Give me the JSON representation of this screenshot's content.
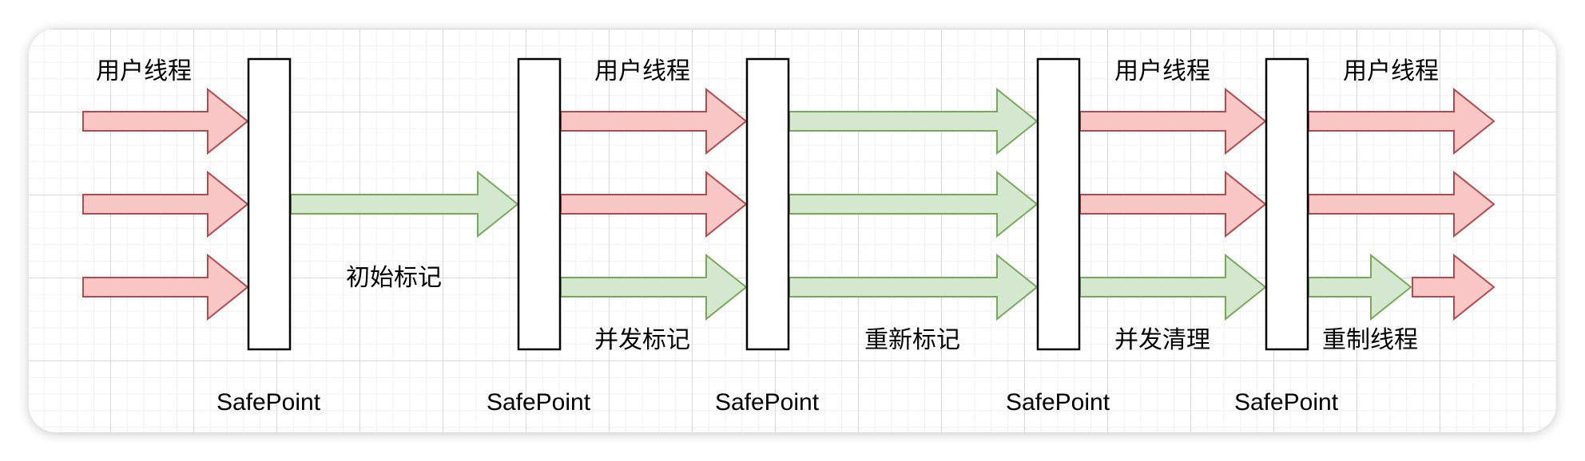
{
  "diagram": {
    "colors": {
      "user_fill": "#f8c7c6",
      "user_stroke": "#b8494b",
      "gc_fill": "#d4e8cf",
      "gc_stroke": "#74ab55",
      "bar_stroke": "#000000"
    },
    "phase_labels": {
      "user_thread_1": "用户线程",
      "user_thread_2": "用户线程",
      "user_thread_3": "用户线程",
      "user_thread_4": "用户线程",
      "initial_mark": "初始标记",
      "concurrent_mark": "并发标记",
      "remark": "重新标记",
      "concurrent_sweep": "并发清理",
      "reset_thread": "重制线程"
    },
    "safepoints": [
      "SafePoint",
      "SafePoint",
      "SafePoint",
      "SafePoint",
      "SafePoint"
    ]
  }
}
